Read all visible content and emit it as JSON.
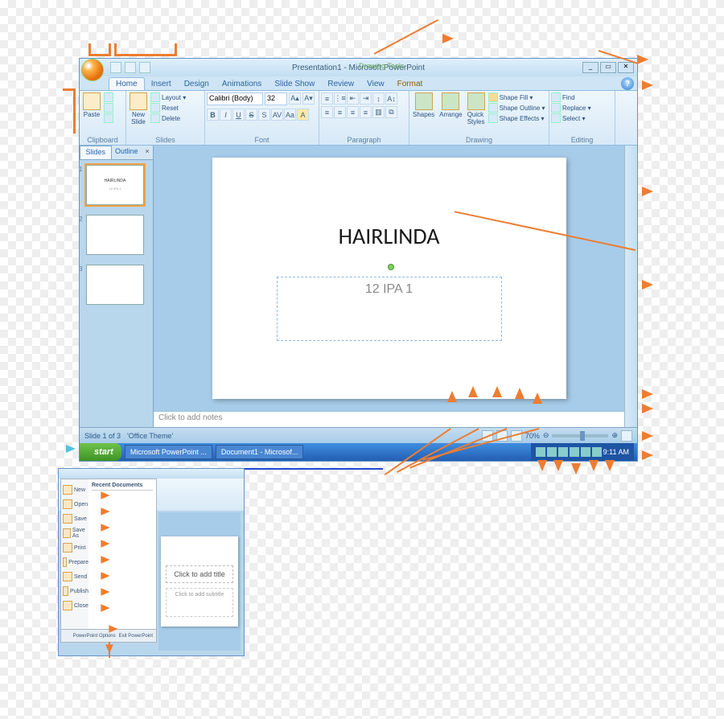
{
  "window": {
    "title": "Presentation1 - Microsoft PowerPoint",
    "context_tool_header": "Drawing Tools",
    "context_tool_tab": "Format",
    "min": "_",
    "max": "▭",
    "close": "✕"
  },
  "ribbon": {
    "tabs": [
      "Home",
      "Insert",
      "Design",
      "Animations",
      "Slide Show",
      "Review",
      "View"
    ],
    "active_tab": "Home",
    "help_glyph": "?",
    "clipboard": {
      "label": "Clipboard",
      "paste": "Paste"
    },
    "slides": {
      "label": "Slides",
      "new_slide": "New\nSlide",
      "layout": "Layout ▾",
      "reset": "Reset",
      "delete": "Delete"
    },
    "font": {
      "label": "Font",
      "font_name": "Calibri (Body)",
      "font_size": "32",
      "bold": "B",
      "italic": "I",
      "underline": "U",
      "strike": "S",
      "shadow": "S",
      "grow": "A▴",
      "shrink": "A▾",
      "clear": "Aa"
    },
    "paragraph": {
      "label": "Paragraph"
    },
    "drawing": {
      "label": "Drawing",
      "shapes": "Shapes",
      "arrange": "Arrange",
      "quick_styles": "Quick\nStyles",
      "shape_fill": "Shape Fill ▾",
      "shape_outline": "Shape Outline ▾",
      "shape_effects": "Shape Effects ▾"
    },
    "editing": {
      "label": "Editing",
      "find": "Find",
      "replace": "Replace ▾",
      "select": "Select ▾"
    }
  },
  "side": {
    "tab_slides": "Slides",
    "tab_outline": "Outline",
    "close": "×",
    "thumb_count": 3,
    "thumb1_line1": "HAIRLINDA",
    "thumb1_line2": "12 IPA 1"
  },
  "slide": {
    "title": "HAIRLINDA",
    "subtitle": "12 IPA 1"
  },
  "notes": {
    "placeholder": "Click to add notes"
  },
  "status": {
    "slide_of": "Slide 1 of 3",
    "theme": "'Office Theme'",
    "zoom": "70%"
  },
  "taskbar": {
    "start": "start",
    "app1": "Microsoft PowerPoint ...",
    "app2": "Document1 - Microsof...",
    "clock": "9:11 AM"
  },
  "office_menu": {
    "recent_header": "Recent Documents",
    "items": [
      "New",
      "Open",
      "Save",
      "Save As",
      "Print",
      "Prepare",
      "Send",
      "Publish",
      "Close"
    ],
    "options": "PowerPoint Options",
    "exit": "Exit PowerPoint"
  },
  "mini_slide": {
    "title_placeholder": "Click to add title",
    "subtitle_placeholder": "Click to add subtitle"
  }
}
